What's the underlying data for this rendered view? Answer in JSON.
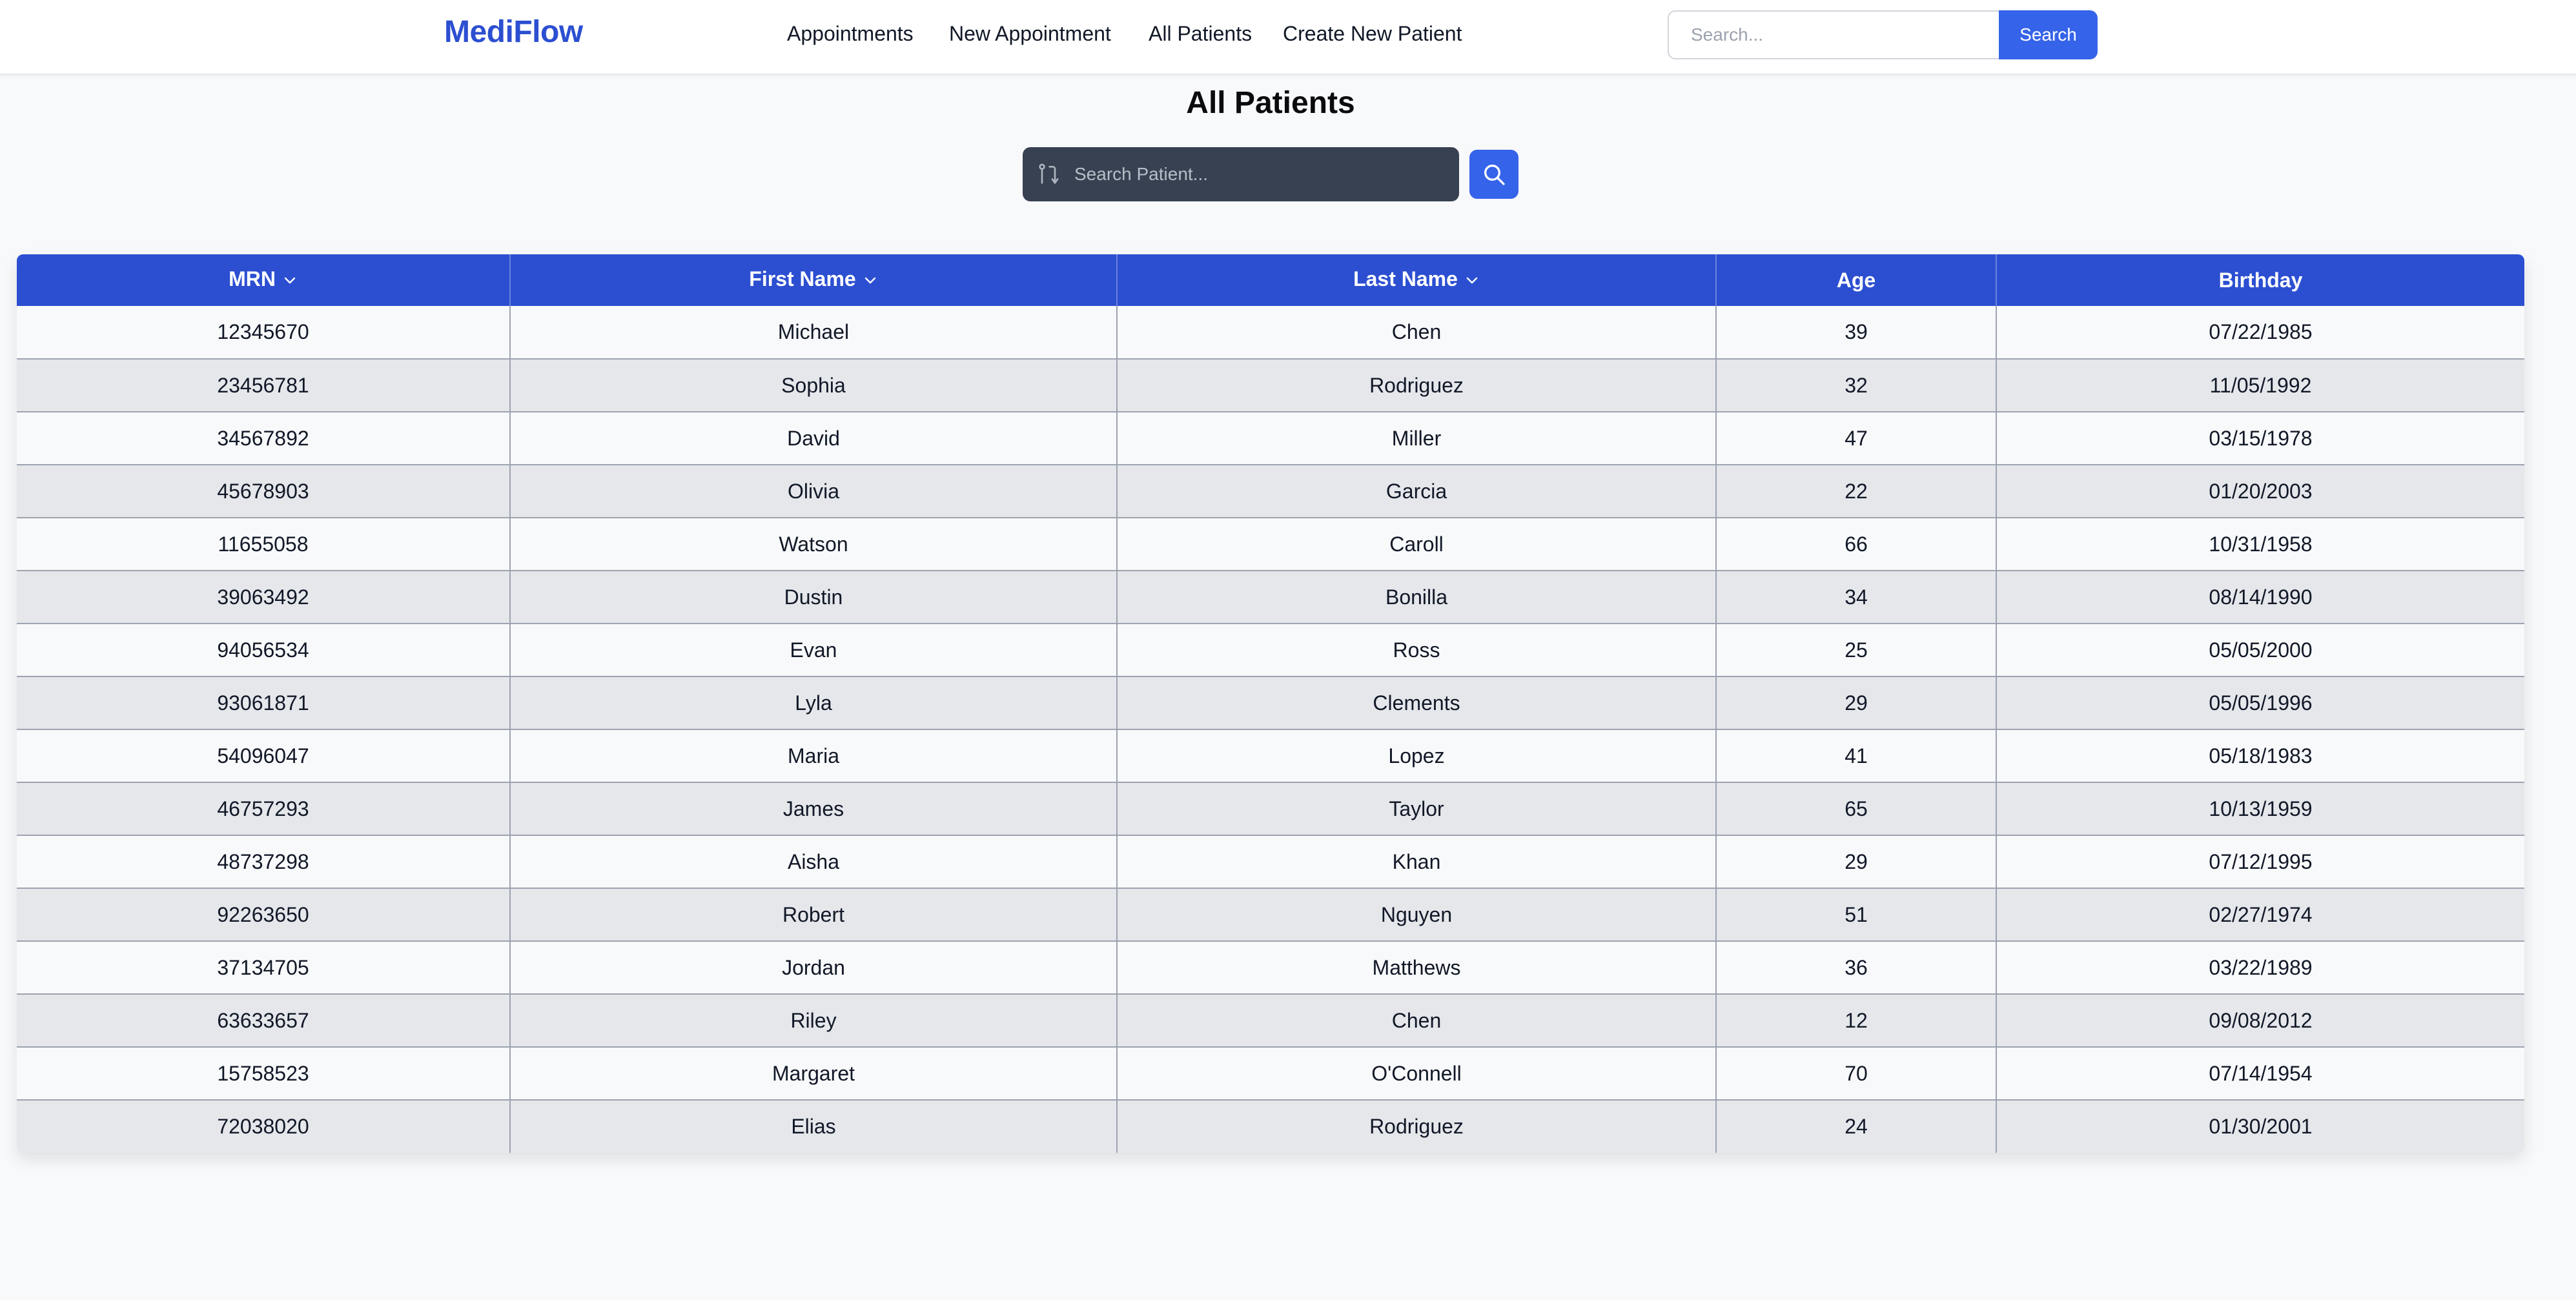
{
  "brand": "MediFlow",
  "nav": {
    "links": [
      "Appointments",
      "New Appointment",
      "All Patients",
      "Create New Patient"
    ],
    "search_placeholder": "Search...",
    "search_button": "Search"
  },
  "page": {
    "title": "All Patients",
    "search_placeholder": "Search Patient..."
  },
  "colors": {
    "brand": "#2c4fd1",
    "header": "#2c4fd1",
    "button": "#3563e9",
    "search_box": "#374151"
  },
  "table": {
    "headers": [
      "MRN",
      "First Name",
      "Last Name",
      "Age",
      "Birthday"
    ],
    "sortable": [
      true,
      true,
      true,
      false,
      false
    ],
    "rows": [
      [
        "12345670",
        "Michael",
        "Chen",
        "39",
        "07/22/1985"
      ],
      [
        "23456781",
        "Sophia",
        "Rodriguez",
        "32",
        "11/05/1992"
      ],
      [
        "34567892",
        "David",
        "Miller",
        "47",
        "03/15/1978"
      ],
      [
        "45678903",
        "Olivia",
        "Garcia",
        "22",
        "01/20/2003"
      ],
      [
        "11655058",
        "Watson",
        "Caroll",
        "66",
        "10/31/1958"
      ],
      [
        "39063492",
        "Dustin",
        "Bonilla",
        "34",
        "08/14/1990"
      ],
      [
        "94056534",
        "Evan",
        "Ross",
        "25",
        "05/05/2000"
      ],
      [
        "93061871",
        "Lyla",
        "Clements",
        "29",
        "05/05/1996"
      ],
      [
        "54096047",
        "Maria",
        "Lopez",
        "41",
        "05/18/1983"
      ],
      [
        "46757293",
        "James",
        "Taylor",
        "65",
        "10/13/1959"
      ],
      [
        "48737298",
        "Aisha",
        "Khan",
        "29",
        "07/12/1995"
      ],
      [
        "92263650",
        "Robert",
        "Nguyen",
        "51",
        "02/27/1974"
      ],
      [
        "37134705",
        "Jordan",
        "Matthews",
        "36",
        "03/22/1989"
      ],
      [
        "63633657",
        "Riley",
        "Chen",
        "12",
        "09/08/2012"
      ],
      [
        "15758523",
        "Margaret",
        "O'Connell",
        "70",
        "07/14/1954"
      ],
      [
        "72038020",
        "Elias",
        "Rodriguez",
        "24",
        "01/30/2001"
      ]
    ]
  }
}
